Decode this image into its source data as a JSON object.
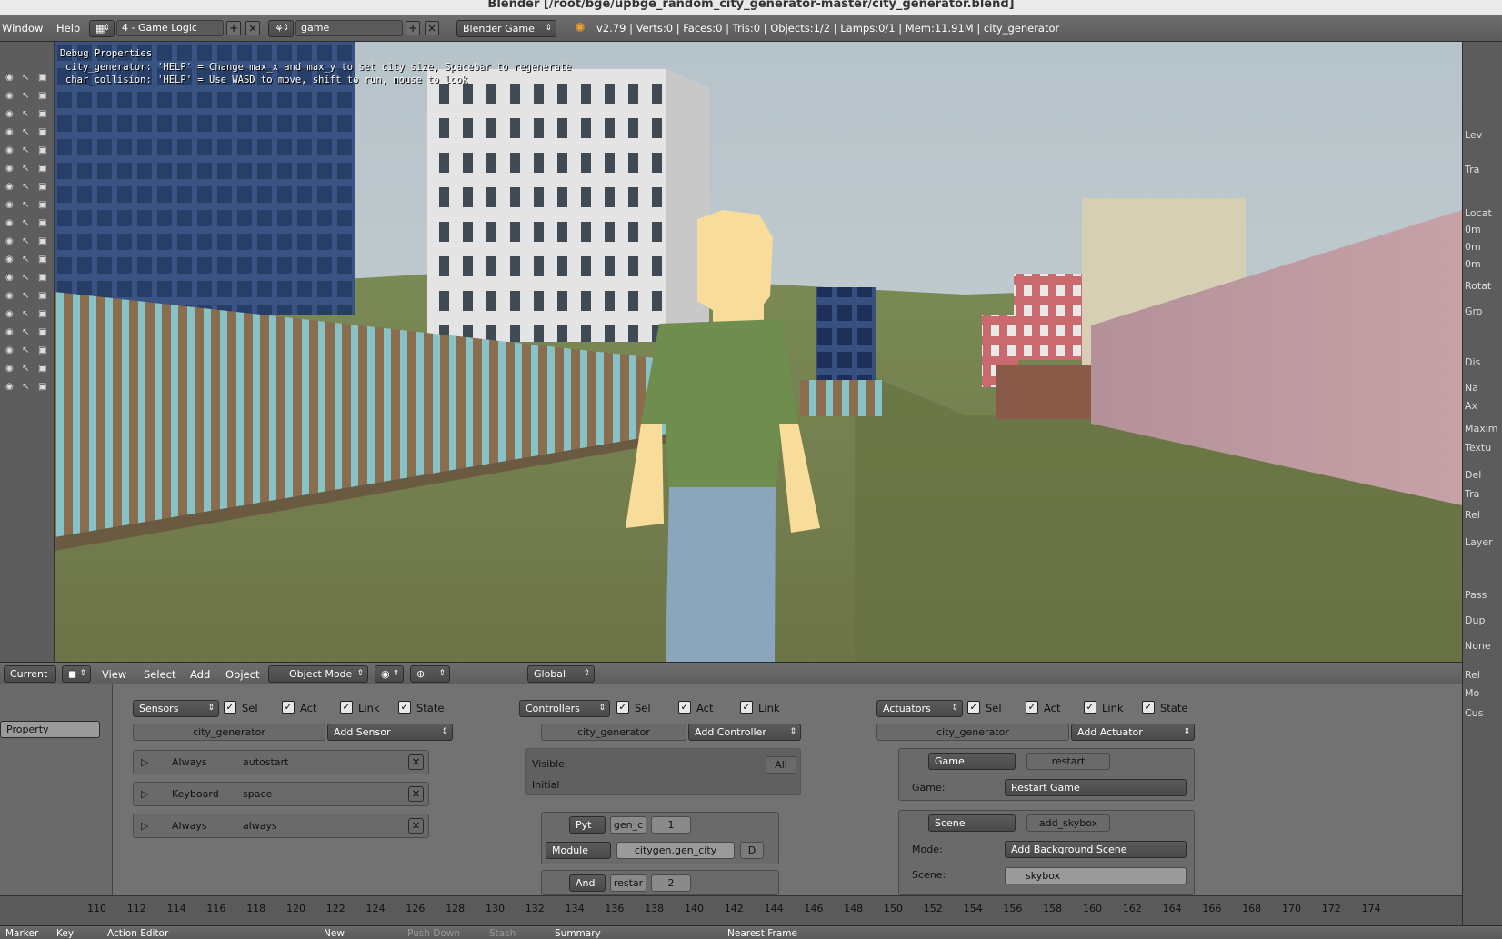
{
  "title": "Blender [/root/bge/upbge_random_city_generator-master/city_generator.blend]",
  "info_bar": {
    "menu": [
      "Window",
      "Help"
    ],
    "screen_layout": "4 - Game Logic",
    "scene": "game",
    "engine": "Blender Game",
    "stats": "v2.79 | Verts:0 | Faces:0 | Tris:0 | Objects:1/2 | Lamps:0/1 | Mem:11.91M | city_generator"
  },
  "viewport": {
    "debug_title": "Debug Properties",
    "debug_lines": [
      "city_generator: 'HELP' = Change max_x and max_y to set city size, Spacebar to regenerate",
      "char_collision: 'HELP' = Use WASD to move, shift to run, mouse to look"
    ]
  },
  "viewport_header": {
    "current": "Current S",
    "menus": [
      "View",
      "Select",
      "Add",
      "Object"
    ],
    "mode": "Object Mode",
    "orientation": "Global"
  },
  "properties_panel": {
    "sections": [
      "Lev",
      "Tra",
      "Locat",
      "0m",
      "0m",
      "0m",
      "Rotat",
      "Gro",
      "Dis",
      "Na",
      "Ax",
      "Maxim",
      "Textu",
      "Del",
      "Tra",
      "Rel",
      "Layer",
      "Pass",
      "Dup",
      "None",
      "Rel",
      "Mo",
      "Cus"
    ]
  },
  "logic": {
    "property_label": "Property",
    "sensors": {
      "header": "Sensors",
      "checks": [
        "Sel",
        "Act",
        "Link",
        "State"
      ],
      "object": "city_generator",
      "add": "Add Sensor",
      "items": [
        {
          "type": "Always",
          "name": "autostart"
        },
        {
          "type": "Keyboard",
          "name": "space"
        },
        {
          "type": "Always",
          "name": "always"
        }
      ]
    },
    "controllers": {
      "header": "Controllers",
      "checks": [
        "Sel",
        "Act",
        "Link"
      ],
      "object": "city_generator",
      "add": "Add Controller",
      "visible": "Visible",
      "initial": "Initial",
      "all": "All",
      "python": {
        "type": "Pyt",
        "name": "gen_c",
        "state": "1",
        "mode": "Module",
        "module": "citygen.gen_city",
        "d": "D"
      },
      "and": {
        "type": "And",
        "name": "restar",
        "state": "2"
      }
    },
    "actuators": {
      "header": "Actuators",
      "checks": [
        "Sel",
        "Act",
        "Link",
        "State"
      ],
      "object": "city_generator",
      "add": "Add Actuator",
      "game": {
        "type": "Game",
        "name": "restart",
        "field_label": "Game:",
        "field_value": "Restart Game"
      },
      "scene": {
        "type": "Scene",
        "name": "add_skybox",
        "mode_label": "Mode:",
        "mode_value": "Add Background Scene",
        "scene_label": "Scene:",
        "scene_value": "skybox"
      }
    }
  },
  "timeline": {
    "ticks": [
      "110",
      "112",
      "114",
      "116",
      "118",
      "120",
      "122",
      "124",
      "126",
      "128",
      "130",
      "132",
      "134",
      "136",
      "138",
      "140",
      "142",
      "144",
      "146",
      "148",
      "150",
      "152",
      "154",
      "156",
      "158",
      "160",
      "162",
      "164",
      "166",
      "168",
      "170",
      "172",
      "174"
    ]
  },
  "bottom_bar": {
    "marker": "Marker",
    "key": "Key",
    "editor": "Action Editor",
    "new": "New",
    "push_down": "Push Down",
    "stash": "Stash",
    "summary": "Summary",
    "snap": "Nearest Frame"
  }
}
